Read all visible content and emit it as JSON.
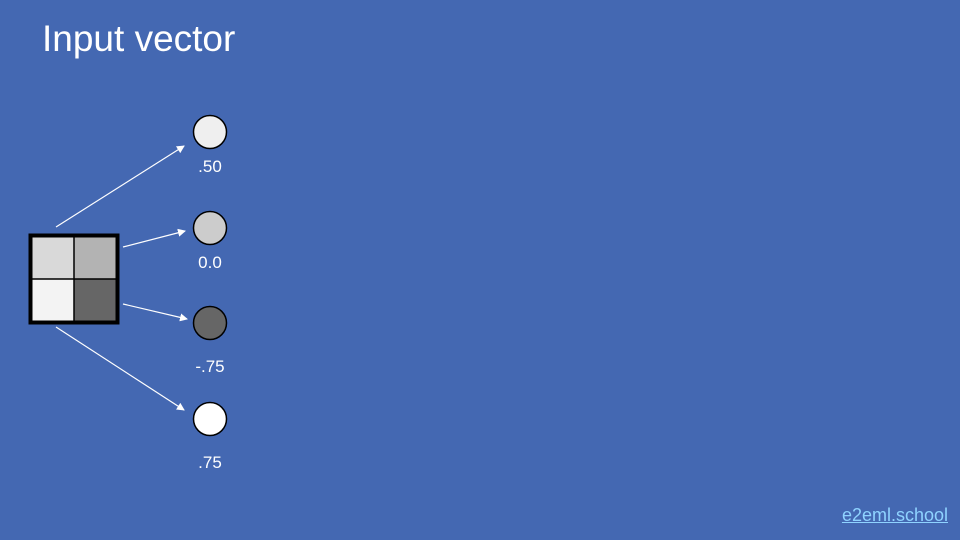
{
  "title": "Input vector",
  "footer": {
    "link_text": "e2eml.school"
  },
  "colors": {
    "background": "#4468b2",
    "text": "#ffffff",
    "link": "#8fd3ff",
    "arrow": "#ffffff",
    "outline": "#000000"
  },
  "input_grid": {
    "cells": [
      "#d9d9d9",
      "#b3b3b3",
      "#f3f3f3",
      "#666666"
    ]
  },
  "nodes": [
    {
      "label": ".50",
      "fill": "#efefef"
    },
    {
      "label": "0.0",
      "fill": "#cccccc"
    },
    {
      "label": "-.75",
      "fill": "#666666"
    },
    {
      "label": ".75",
      "fill": "#ffffff"
    }
  ]
}
